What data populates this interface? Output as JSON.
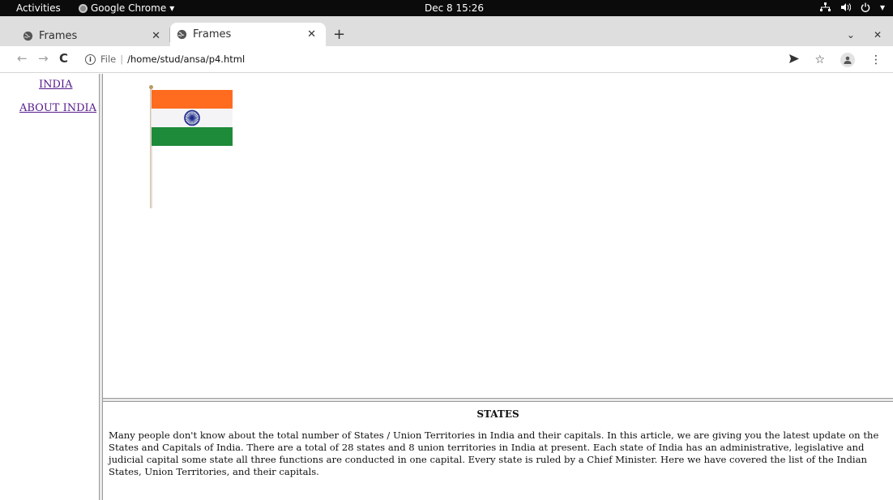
{
  "system_bar": {
    "activities": "Activities",
    "app_name": "Google Chrome",
    "clock": "Dec 8  15:26"
  },
  "browser": {
    "tabs": [
      {
        "title": "Frames",
        "active": false
      },
      {
        "title": "Frames",
        "active": true
      }
    ],
    "file_label": "File",
    "url": "/home/stud/ansa/p4.html"
  },
  "left_frame": {
    "links": [
      {
        "label": "INDIA"
      },
      {
        "label": "ABOUT INDIA"
      }
    ]
  },
  "bottom_frame": {
    "heading": "STATES",
    "paragraph": "Many people don't know about the total number of States / Union Territories in India and their capitals. In this article, we are giving you the latest update on the States and Capitals of India. There are a total of 28 states and 8 union territories in India at present. Each state of India has an administrative, legislative and judicial capital some state all three functions are conducted in one capital. Every state is ruled by a Chief Minister. Here we have covered the list of the Indian States, Union Territories, and their capitals."
  },
  "colors": {
    "saffron": "#ff6b1f",
    "white": "#f4f4f6",
    "green": "#1e8b3a",
    "chakra": "#1b2a8a",
    "visited_link": "#551a8b"
  }
}
